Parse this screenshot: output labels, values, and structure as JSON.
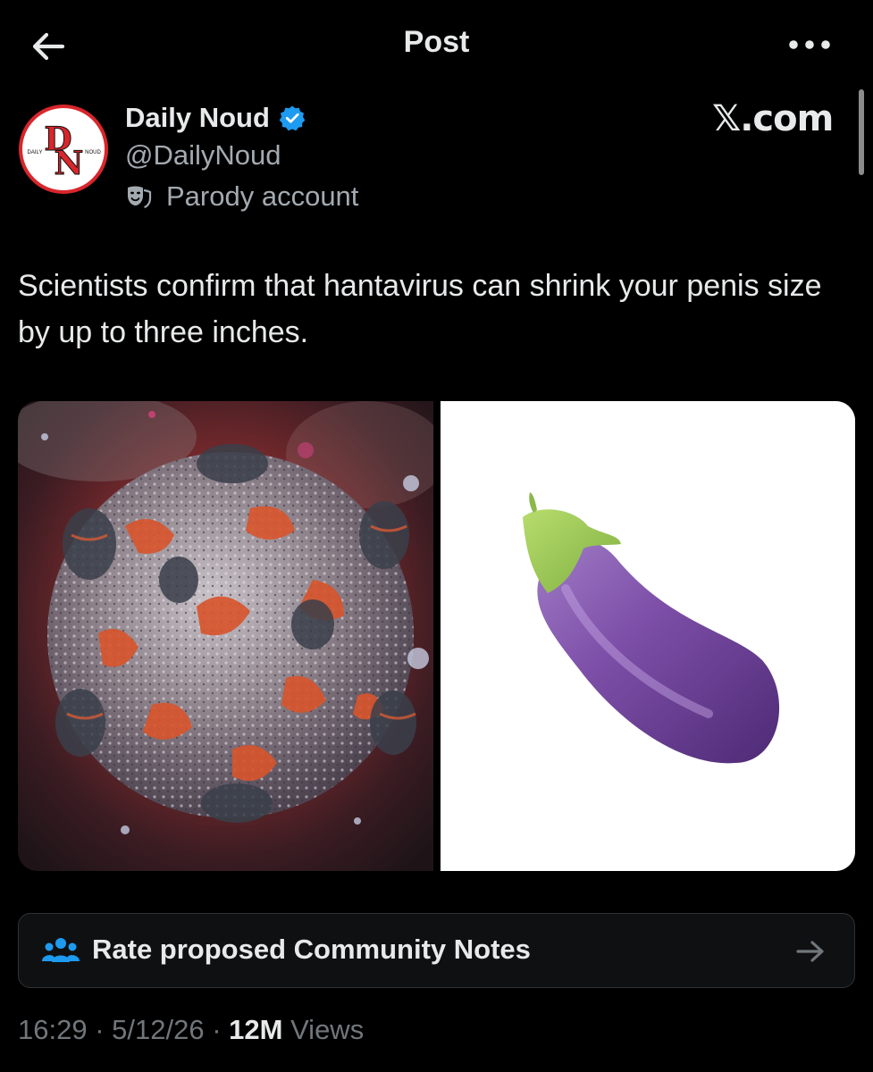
{
  "topbar": {
    "title": "Post",
    "back_icon": "arrow-left-icon",
    "more_icon": "more-horizontal-icon"
  },
  "author": {
    "display_name": "Daily Noud",
    "handle": "@DailyNoud",
    "parody_label": "Parody account",
    "verified_icon": "verified-badge-icon",
    "avatar_text": {
      "left": "DAILY",
      "right": "NOUD",
      "monogram_top": "D",
      "monogram_bottom": "N"
    }
  },
  "watermark": "𝕏.com",
  "post": {
    "text": "Scientists confirm that hantavirus can shrink your penis size by up to three inches.",
    "media": [
      {
        "kind": "image",
        "subject": "virus-particle"
      },
      {
        "kind": "image",
        "subject": "eggplant-emoji"
      }
    ]
  },
  "community_notes": {
    "label": "Rate proposed Community Notes",
    "icon": "people-group-icon",
    "arrow_icon": "arrow-right-icon"
  },
  "meta": {
    "time": "16:29",
    "sep1": " · ",
    "date": "5/12/26",
    "sep2": " · ",
    "views_count": "12M",
    "views_label": " Views"
  },
  "colors": {
    "background": "#000000",
    "text": "#e7e9ea",
    "secondary_text": "#71767b",
    "verified_blue": "#1d9bf0",
    "notes_icon_blue": "#1d9bf0",
    "avatar_red": "#d8262c"
  }
}
